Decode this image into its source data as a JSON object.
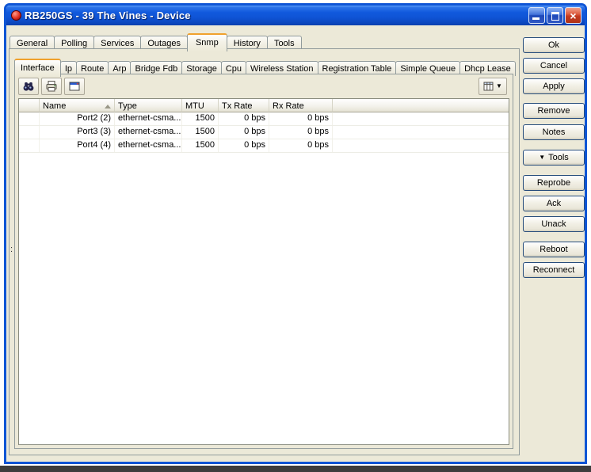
{
  "window": {
    "title": "RB250GS - 39 The Vines - Device",
    "controls": {
      "close": "×"
    }
  },
  "main_tabs": {
    "items": [
      "General",
      "Polling",
      "Services",
      "Outages",
      "Snmp",
      "History",
      "Tools"
    ],
    "selected": "Snmp"
  },
  "snmp_tabs": {
    "items": [
      "Interface",
      "Ip",
      "Route",
      "Arp",
      "Bridge Fdb",
      "Storage",
      "Cpu",
      "Wireless Station",
      "Registration Table",
      "Simple Queue",
      "Dhcp Lease"
    ],
    "selected": "Interface"
  },
  "toolbar": {
    "icons": [
      "find-icon",
      "print-icon",
      "panel-icon"
    ],
    "columns_icon": "columns-icon",
    "dropdown_arrow": "▼"
  },
  "table": {
    "headers": {
      "name": "Name",
      "type": "Type",
      "mtu": "MTU",
      "tx": "Tx Rate",
      "rx": "Rx Rate"
    },
    "sort": {
      "column": "Name",
      "direction": "asc"
    },
    "rows": [
      {
        "name": "Port2 (2)",
        "type": "ethernet-csma...",
        "mtu": "1500",
        "tx_rate": "0 bps",
        "rx_rate": "0 bps"
      },
      {
        "name": "Port3 (3)",
        "type": "ethernet-csma...",
        "mtu": "1500",
        "tx_rate": "0 bps",
        "rx_rate": "0 bps"
      },
      {
        "name": "Port4 (4)",
        "type": "ethernet-csma...",
        "mtu": "1500",
        "tx_rate": "0 bps",
        "rx_rate": "0 bps"
      }
    ]
  },
  "side_buttons": {
    "ok": "Ok",
    "cancel": "Cancel",
    "apply": "Apply",
    "remove": "Remove",
    "notes": "Notes",
    "tools": "Tools",
    "tools_arrow": "▼",
    "reprobe": "Reprobe",
    "ack": "Ack",
    "unack": "Unack",
    "reboot": "Reboot",
    "reconnect": "Reconnect"
  },
  "misc": {
    "stray_text": ":"
  },
  "colors": {
    "window_bg": "#ece9d8",
    "titlebar_top": "#5a9cf8",
    "titlebar_bottom": "#0a3fae",
    "border_blue": "#0f55d5",
    "close_red": "#c33a1f",
    "selected_tab_accent": "#f0a12c",
    "device_icon_red": "#e03020"
  }
}
